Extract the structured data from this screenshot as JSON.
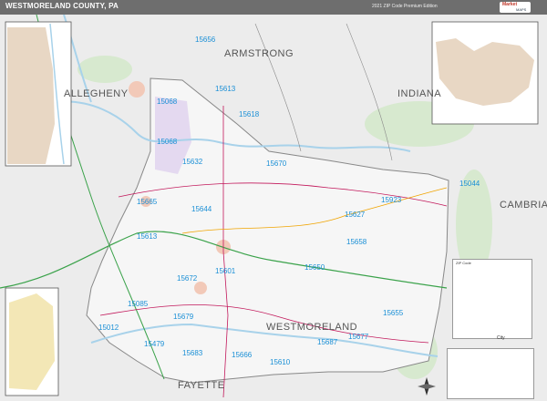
{
  "header": {
    "title": "WESTMORELAND COUNTY, PA",
    "edition": "2021 ZIP Code Premium Edition",
    "logo_line1": "Market",
    "logo_line2": "MAPS"
  },
  "counties": [
    {
      "name": "ARMSTRONG"
    },
    {
      "name": "INDIANA"
    },
    {
      "name": "CAMBRIA"
    },
    {
      "name": "WESTMORELAND"
    },
    {
      "name": "FAYETTE"
    },
    {
      "name": "ALLEGHENY"
    }
  ],
  "zip_codes": [
    "15656",
    "15613",
    "15068",
    "15618",
    "15068",
    "15632",
    "15670",
    "15644",
    "15923",
    "15627",
    "15665",
    "15613",
    "15658",
    "15672",
    "15601",
    "15650",
    "15655",
    "15085",
    "15679",
    "15012",
    "15479",
    "15683",
    "15687",
    "15677",
    "15666",
    "15610",
    "15044"
  ],
  "colors": {
    "title_bar": "#6e6e6e",
    "zip_label": "#1a8fd6",
    "county_fill": "#f6f6f6",
    "forest": "#d7e9cf",
    "urban": "#f2c9b8",
    "river": "#a8d2ea",
    "highway": "#3aa24a",
    "road_major": "#c2185b"
  },
  "insets": [
    {
      "name": "inset-west-city"
    },
    {
      "name": "inset-northeast-town"
    },
    {
      "name": "inset-southwest-city"
    }
  ],
  "legend": {
    "title": "ZIP Code",
    "scale_text": "City"
  }
}
